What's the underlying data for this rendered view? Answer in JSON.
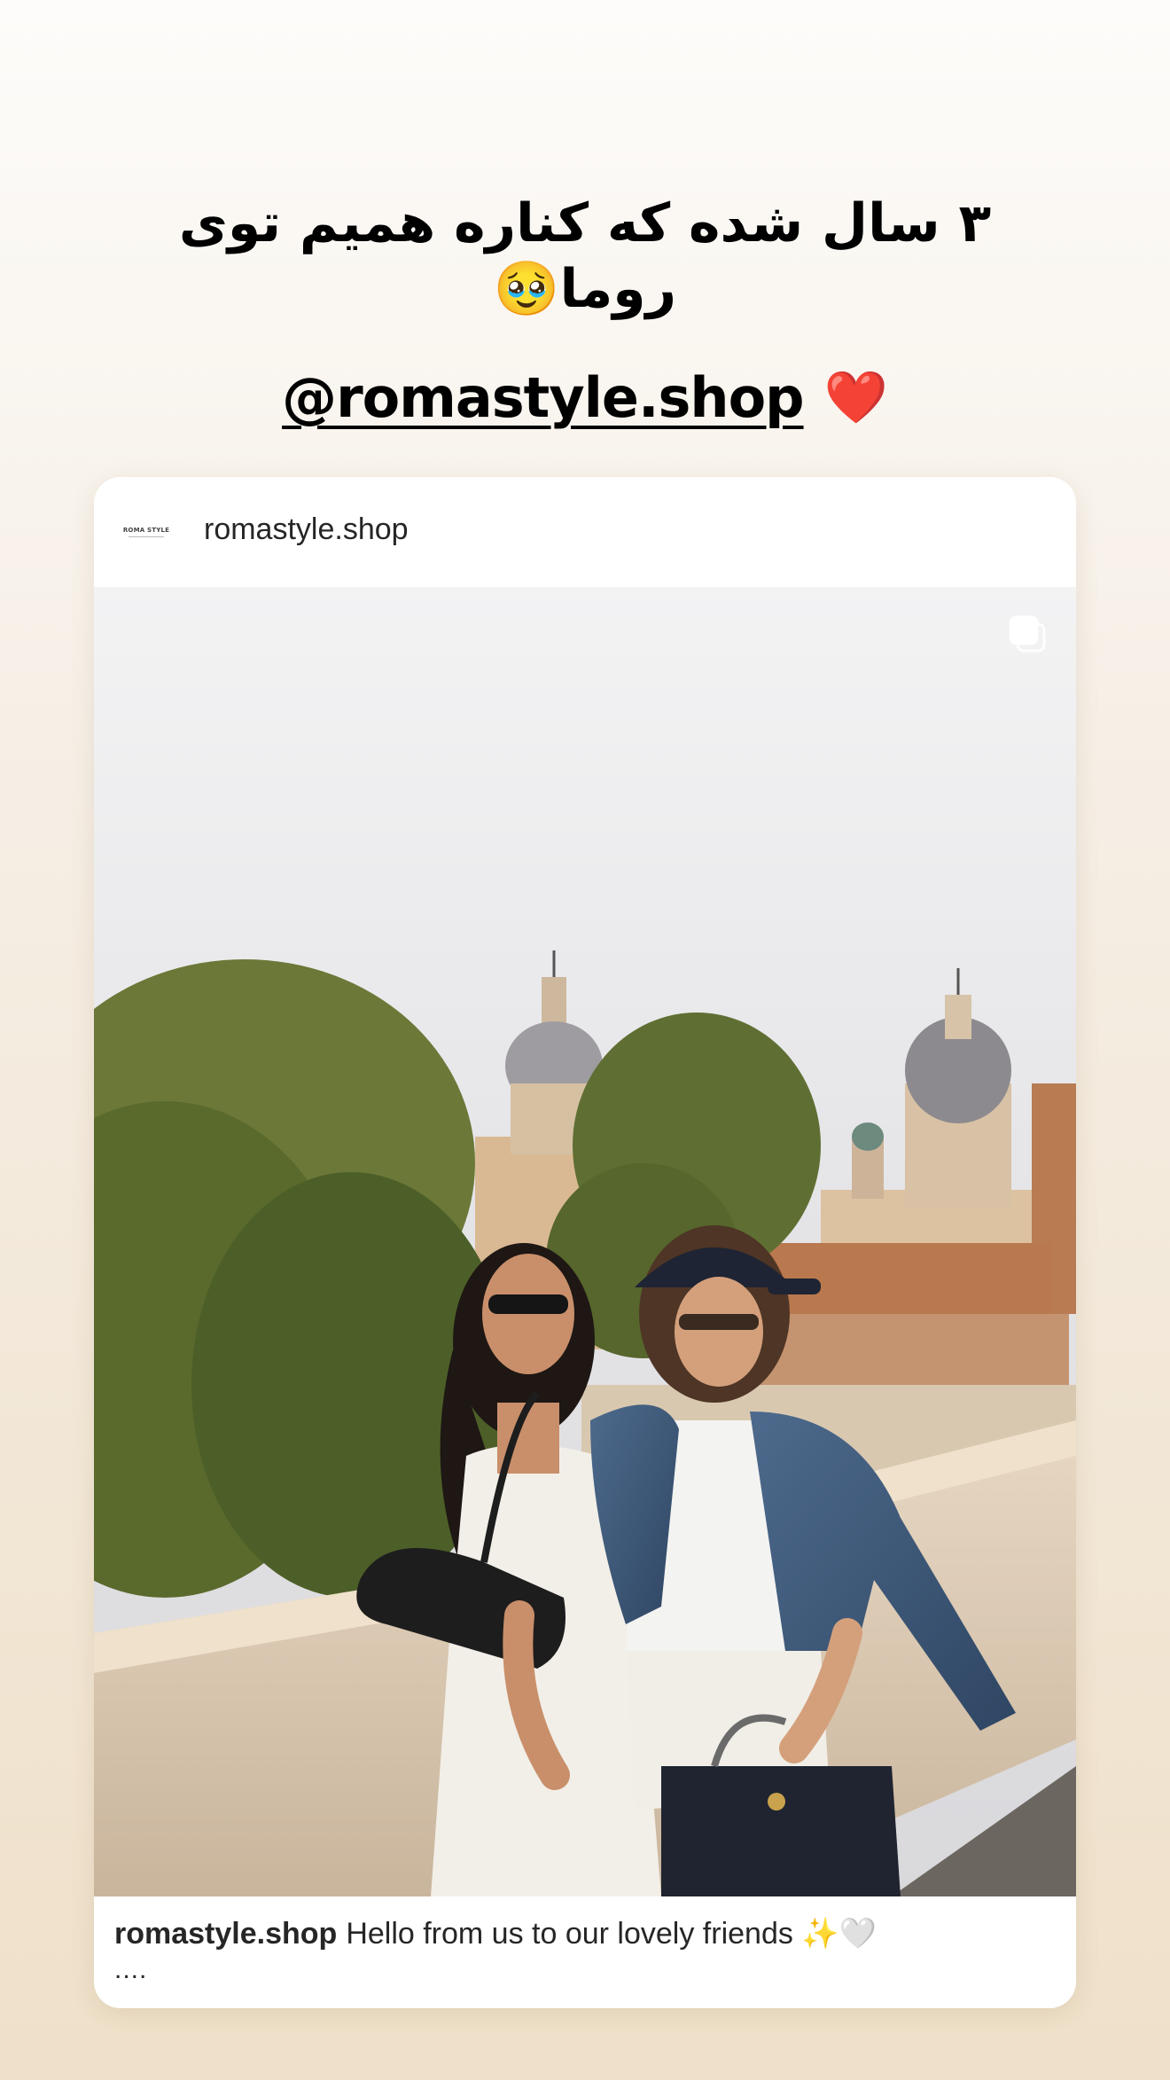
{
  "story": {
    "caption": "۳ سال شده که کناره همیم توی روما🥹",
    "mention": "@romastyle.shop",
    "heart": "❤️"
  },
  "post": {
    "avatar_text": "ROMA STYLE",
    "username": "romastyle.shop",
    "multi_image_icon": "carousel-icon",
    "caption_user": "romastyle.shop",
    "caption_text": "Hello from us to our lovely friends ✨🤍",
    "more": "...."
  }
}
